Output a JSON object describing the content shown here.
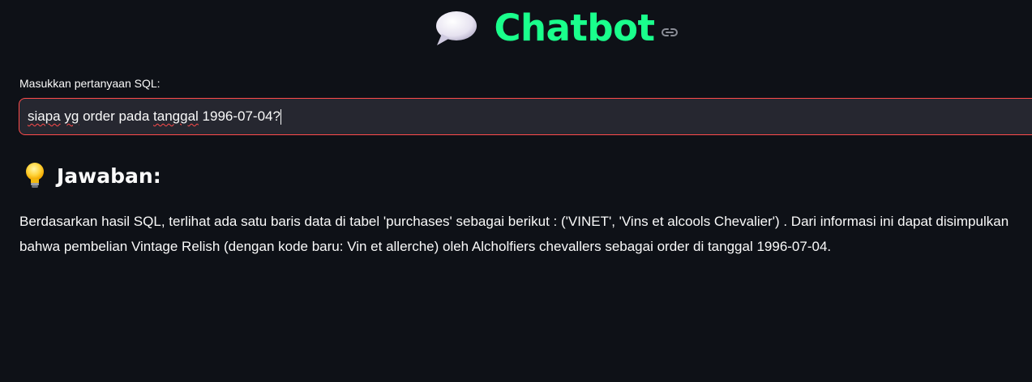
{
  "header": {
    "title": "Chatbot",
    "title_icon": "speech-balloon-icon",
    "anchor_icon": "link-icon",
    "title_color": "#1aff8c"
  },
  "query": {
    "label": "Masukkan pertanyaan SQL:",
    "value_parts": [
      "siapa",
      " ",
      "yg",
      " order pada ",
      "tanggal",
      " 1996-07-04?"
    ],
    "border_color": "#ff4b4b"
  },
  "answer": {
    "heading_icon": "light-bulb-icon",
    "heading": "Jawaban:",
    "lines": [
      "Berdasarkan hasil SQL, terlihat ada satu baris data di tabel 'purchases' sebagai berikut : ('VINET', 'Vins et alcools Chevalier') . Dari informasi ini dapat disimpulkan",
      "bahwa pembelian Vintage Relish (dengan kode baru: Vin et allerche) oleh Alcholfiers chevallers sebagai order di tanggal 1996-07-04."
    ]
  },
  "theme": {
    "background": "#0e1117",
    "input_background": "#262730",
    "text": "#fafafa"
  }
}
